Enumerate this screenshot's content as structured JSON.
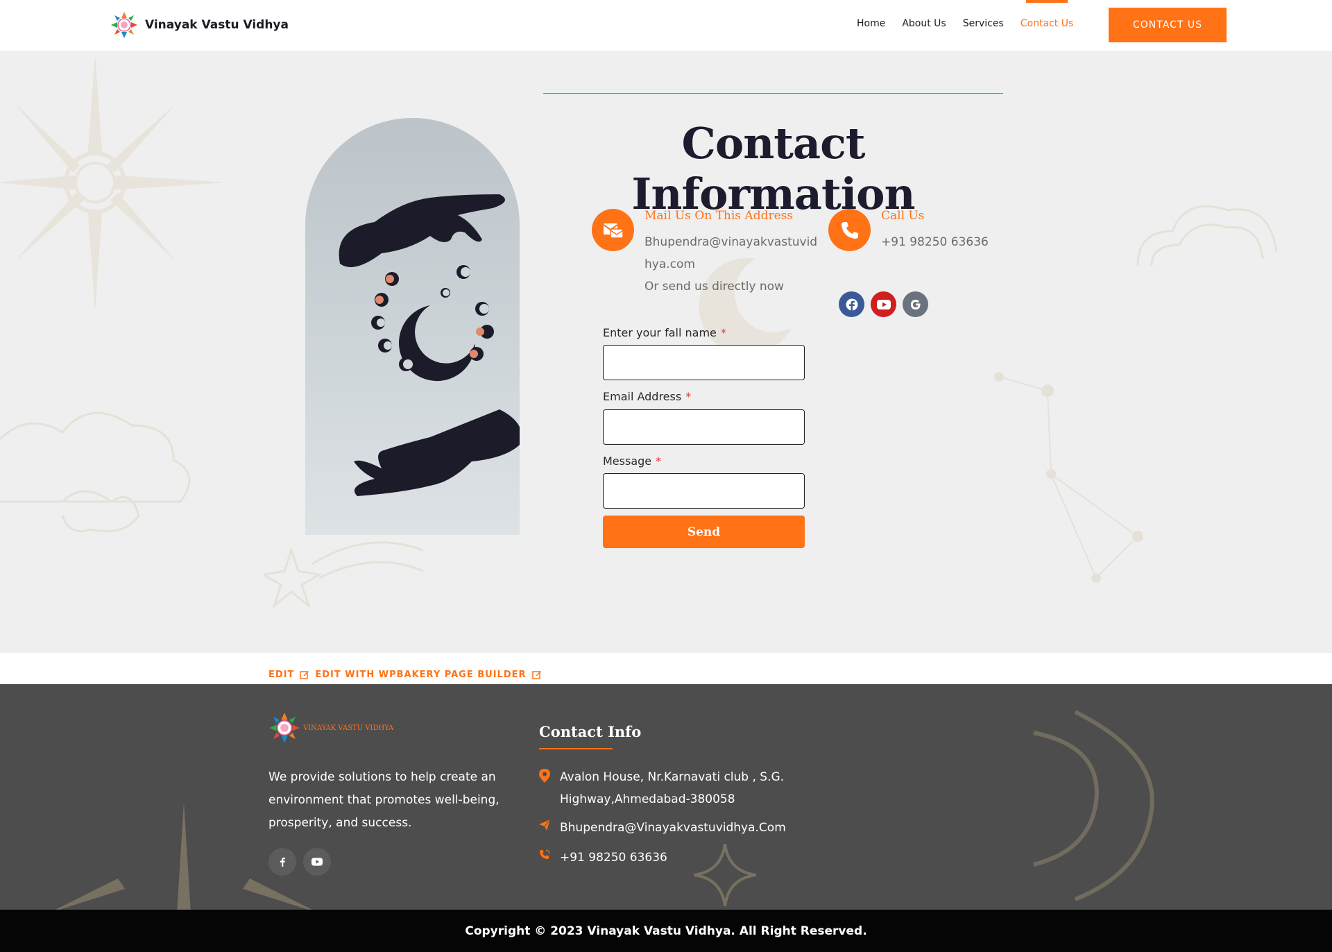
{
  "header": {
    "brand": "Vinayak Vastu Vidhya",
    "nav": [
      "Home",
      "About Us",
      "Services",
      "Contact Us"
    ],
    "active_nav": "Contact Us",
    "cta": "CONTACT US"
  },
  "main": {
    "title": "Contact Information",
    "mail": {
      "heading": "Mail Us On This Address",
      "line1": "Bhupendra@vinayakvastuvid",
      "line2": "hya.com",
      "line3": "Or send us directly now"
    },
    "call": {
      "heading": "Call Us",
      "phone": "+91 98250 63636"
    },
    "social_icons": [
      "facebook-icon",
      "youtube-icon",
      "google-icon"
    ],
    "form": {
      "name_label": "Enter your fall name",
      "email_label": "Email Address",
      "message_label": "Message",
      "required_mark": "*",
      "name_value": "",
      "email_value": "",
      "message_value": "",
      "send": "Send"
    }
  },
  "edit_bar": {
    "edit": "EDIT",
    "edit_wpbakery": "EDIT WITH WPBAKERY PAGE BUILDER"
  },
  "footer": {
    "logo_text": "VINAYAK VASTU VIDHYA",
    "description": "We provide solutions to help create an environment that promotes well-being, prosperity, and success.",
    "contact_heading": "Contact Info",
    "address": "Avalon House, Nr.Karnavati club , S.G. Highway,Ahmedabad-380058",
    "email": "Bhupendra@Vinayakvastuvidhya.Com",
    "phone": "+91 98250 63636",
    "social_icons": [
      "facebook-icon",
      "youtube-icon"
    ]
  },
  "copyright": "Copyright © 2023 Vinayak Vastu Vidhya. All Right Reserved.",
  "colors": {
    "accent": "#ff7216",
    "dark": "#1c1c2e",
    "facebook": "#3b5998",
    "youtube": "#cd201f",
    "google": "#69727d",
    "footer_bg": "#4d4d4d"
  }
}
